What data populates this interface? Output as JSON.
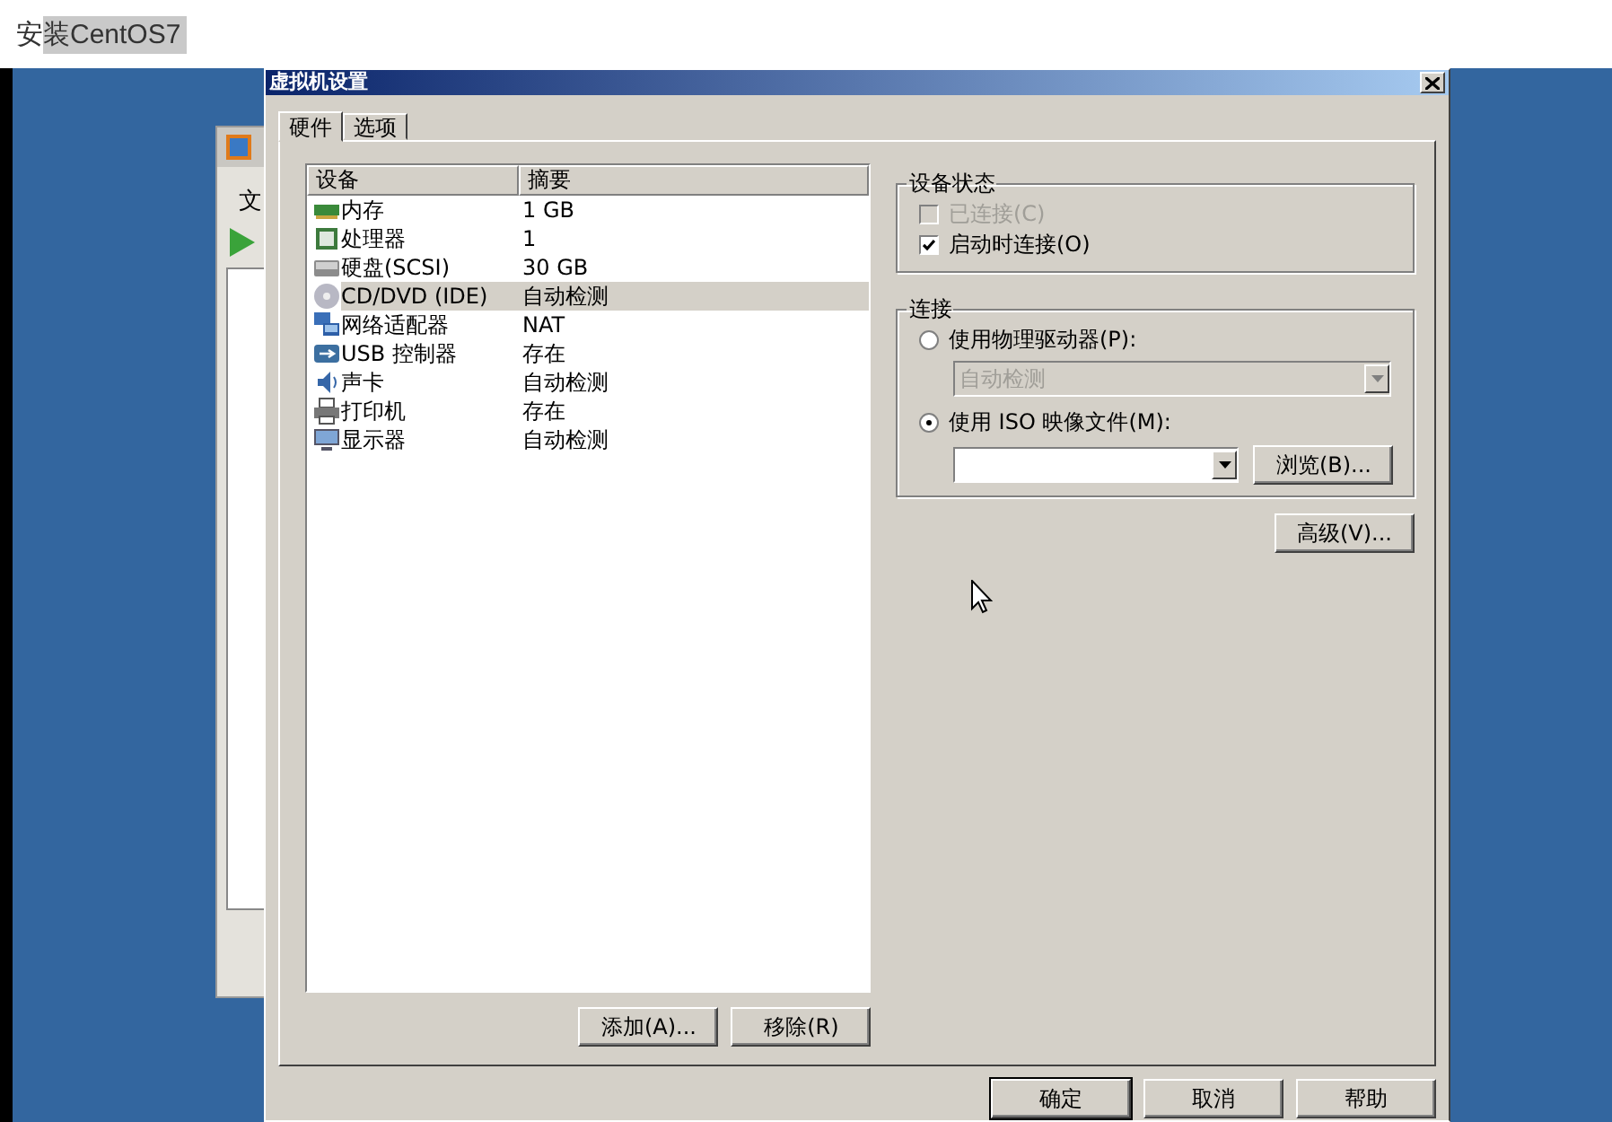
{
  "page_heading": "安装CentOS7",
  "background_window": {
    "menu_text": "文"
  },
  "dialog": {
    "title": "虚拟机设置",
    "tabs": [
      {
        "label": "硬件",
        "selected": true
      },
      {
        "label": "选项",
        "selected": false
      }
    ],
    "device_table": {
      "columns": [
        "设备",
        "摘要"
      ],
      "rows": [
        {
          "kind": "memory",
          "device": "内存",
          "summary": "1 GB",
          "selected": false
        },
        {
          "kind": "cpu",
          "device": "处理器",
          "summary": "1",
          "selected": false
        },
        {
          "kind": "disk",
          "device": "硬盘(SCSI)",
          "summary": "30 GB",
          "selected": false
        },
        {
          "kind": "cd",
          "device": "CD/DVD (IDE)",
          "summary": "自动检测",
          "selected": true
        },
        {
          "kind": "network",
          "device": "网络适配器",
          "summary": "NAT",
          "selected": false
        },
        {
          "kind": "usb",
          "device": "USB 控制器",
          "summary": "存在",
          "selected": false
        },
        {
          "kind": "sound",
          "device": "声卡",
          "summary": "自动检测",
          "selected": false
        },
        {
          "kind": "printer",
          "device": "打印机",
          "summary": "存在",
          "selected": false
        },
        {
          "kind": "display",
          "device": "显示器",
          "summary": "自动检测",
          "selected": false
        }
      ]
    },
    "list_buttons": [
      "添加(A)...",
      "移除(R)"
    ],
    "device_status": {
      "title": "设备状态",
      "options": [
        {
          "label": "已连接(C)",
          "checked": false,
          "disabled": true
        },
        {
          "label": "启动时连接(O)",
          "checked": true,
          "disabled": false
        }
      ]
    },
    "connection": {
      "title": "连接",
      "physical_drive": {
        "label": "使用物理驱动器(P):",
        "selected": false,
        "dropdown_value": "自动检测",
        "dropdown_disabled": true
      },
      "iso_image": {
        "label": "使用 ISO 映像文件(M):",
        "selected": true,
        "browse_button": "浏览(B)..."
      }
    },
    "advanced_button": "高级(V)...",
    "footer_buttons": [
      {
        "label": "确定",
        "default": true
      },
      {
        "label": "取消",
        "default": false
      },
      {
        "label": "帮助",
        "default": false
      }
    ]
  }
}
